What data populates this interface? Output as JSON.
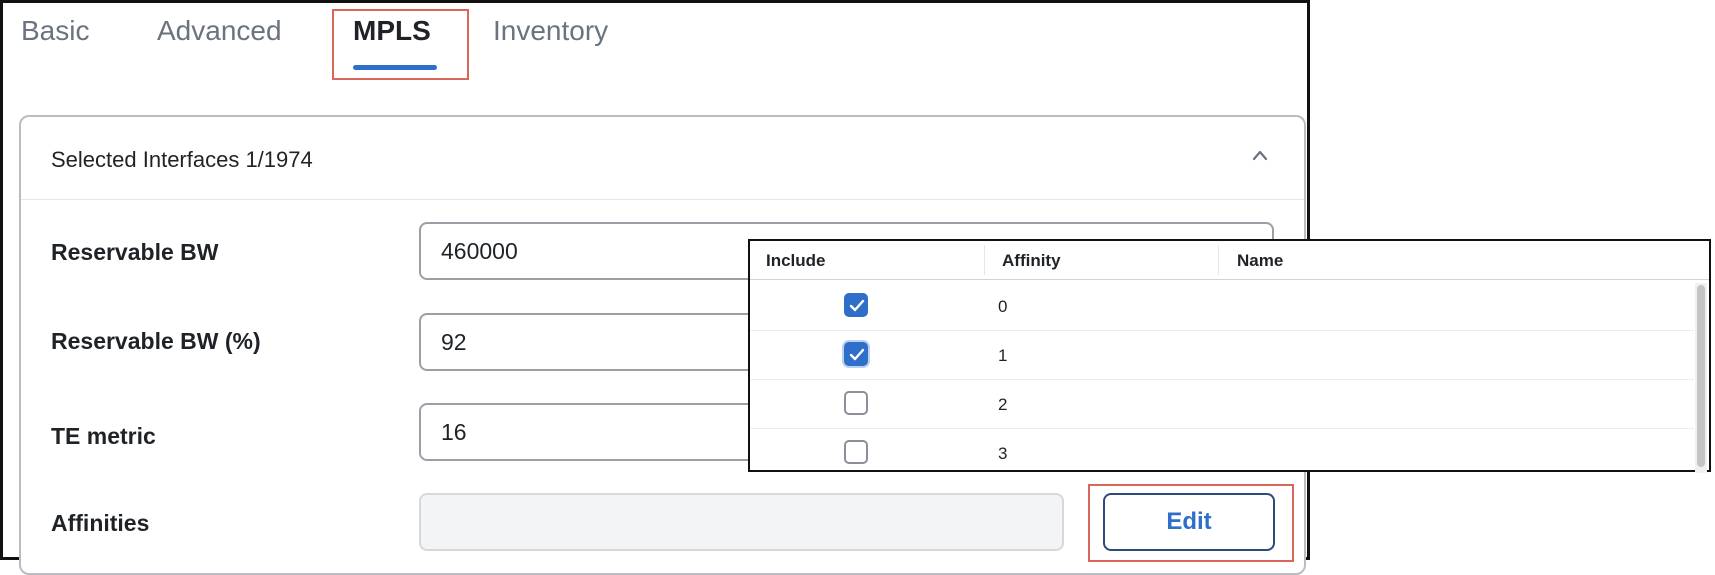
{
  "tabs": [
    {
      "label": "Basic",
      "active": false
    },
    {
      "label": "Advanced",
      "active": false
    },
    {
      "label": "MPLS",
      "active": true
    },
    {
      "label": "Inventory",
      "active": false
    }
  ],
  "panel": {
    "title": "Selected Interfaces 1/1974",
    "collapse_icon": "chevron-up-icon"
  },
  "fields": {
    "reservable_bw": {
      "label": "Reservable BW",
      "value": "460000"
    },
    "reservable_bw_pct": {
      "label": "Reservable BW (%)",
      "value": "92"
    },
    "te_metric": {
      "label": "TE metric",
      "value": "16"
    },
    "affinities": {
      "label": "Affinities",
      "value": ""
    }
  },
  "edit_button": {
    "label": "Edit"
  },
  "affinity_table": {
    "columns": [
      "Include",
      "Affinity",
      "Name"
    ],
    "rows": [
      {
        "include": true,
        "affinity": "0",
        "name": ""
      },
      {
        "include": true,
        "affinity": "1",
        "name": ""
      },
      {
        "include": false,
        "affinity": "2",
        "name": ""
      },
      {
        "include": false,
        "affinity": "3",
        "name": ""
      }
    ]
  },
  "colors": {
    "accent": "#2f6fca",
    "highlight": "#d9665a",
    "tab_inactive": "#6b7280"
  }
}
